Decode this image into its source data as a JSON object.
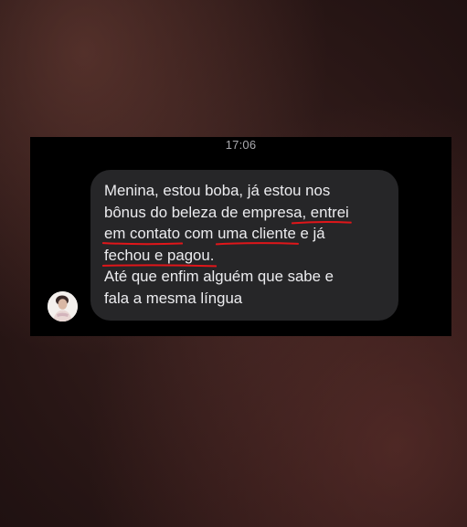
{
  "status": {
    "time": "17:06"
  },
  "message": {
    "sender_avatar": "contact-avatar",
    "lines": [
      {
        "parts": [
          {
            "t": "Menina, estou boba, já estou nos",
            "hl": false
          }
        ]
      },
      {
        "parts": [
          {
            "t": "bônus do beleza de empres",
            "hl": false
          },
          {
            "t": "a, entrei",
            "hl": true
          }
        ]
      },
      {
        "parts": [
          {
            "t": "em contato",
            "hl": true
          },
          {
            "t": " com ",
            "hl": false
          },
          {
            "t": "uma cliente",
            "hl": true
          },
          {
            "t": " e já",
            "hl": false
          }
        ]
      },
      {
        "parts": [
          {
            "t": "fechou e pagou.",
            "hl": true
          }
        ]
      },
      {
        "parts": [
          {
            "t": "Até que enfim alguém que sabe e",
            "hl": false
          }
        ]
      },
      {
        "parts": [
          {
            "t": "fala a mesma língua",
            "hl": false
          }
        ]
      }
    ]
  },
  "colors": {
    "underline": "#e0161a",
    "bubble": "#262628",
    "text": "#ececef"
  }
}
